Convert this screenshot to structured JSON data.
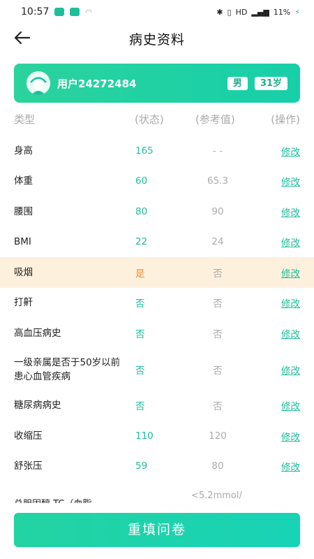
{
  "status_bar": {
    "time": "10:57",
    "indicators": "HD",
    "battery": "11%"
  },
  "header": {
    "title": "病史资料"
  },
  "user": {
    "name": "用户24272484",
    "gender": "男",
    "age": "31岁"
  },
  "table": {
    "columns": {
      "type": "类型",
      "status": "(状态)",
      "reference": "(参考值)",
      "action": "(操作)"
    },
    "rows": [
      {
        "type": "身高",
        "status": "165",
        "reference": "- -",
        "action": "修改"
      },
      {
        "type": "体重",
        "status": "60",
        "reference": "65.3",
        "action": "修改"
      },
      {
        "type": "腰围",
        "status": "80",
        "reference": "90",
        "action": "修改"
      },
      {
        "type": "BMI",
        "status": "22",
        "reference": "24",
        "action": "修改"
      },
      {
        "type": "吸烟",
        "status": "是",
        "reference": "否",
        "action": "修改",
        "highlighted": true
      },
      {
        "type": "打鼾",
        "status": "否",
        "reference": "否",
        "action": "修改"
      },
      {
        "type": "高血压病史",
        "status": "否",
        "reference": "否",
        "action": "修改"
      },
      {
        "type": "一级亲属是否于50岁以前患心血管疾病",
        "status": "否",
        "reference": "否",
        "action": "修改"
      },
      {
        "type": "糖尿病病史",
        "status": "否",
        "reference": "否",
        "action": "修改"
      },
      {
        "type": "收缩压",
        "status": "110",
        "reference": "120",
        "action": "修改"
      },
      {
        "type": "舒张压",
        "status": "59",
        "reference": "80",
        "action": "修改"
      }
    ],
    "partial_row": {
      "type": "总胆固醇 TC（血脂",
      "reference": "<5.2mmol/"
    }
  },
  "footer": {
    "submit_label": "重填问卷"
  },
  "colors": {
    "accent": "#1dbf9a",
    "highlight_bg": "#fdf1de",
    "highlight_text": "#e8913a"
  },
  "icons": [
    "back-arrow-icon",
    "avatar-icon",
    "bluetooth-icon",
    "signal-icon",
    "battery-icon"
  ]
}
